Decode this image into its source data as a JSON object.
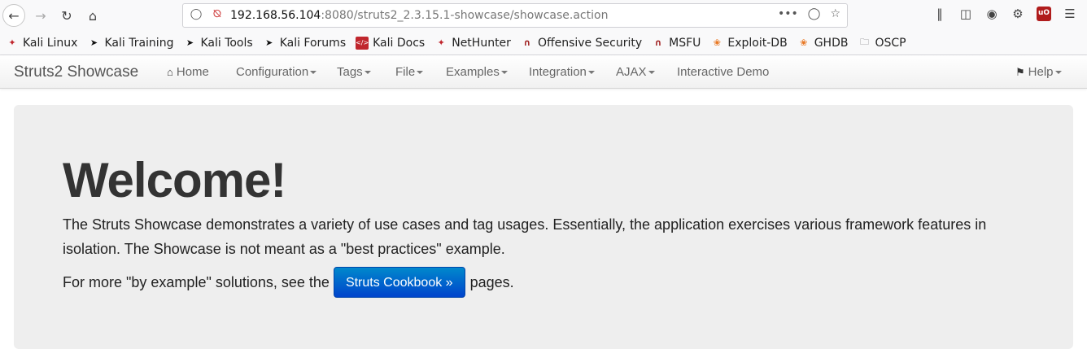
{
  "browser": {
    "url_host": "192.168.56.104",
    "url_path": ":8080/struts2_2.3.15.1-showcase/showcase.action",
    "bookmarks": [
      {
        "label": "Kali Linux",
        "icon": "kali-icon"
      },
      {
        "label": "Kali Training",
        "icon": "dragon-icon"
      },
      {
        "label": "Kali Tools",
        "icon": "dragon-icon"
      },
      {
        "label": "Kali Forums",
        "icon": "dragon-icon"
      },
      {
        "label": "Kali Docs",
        "icon": "docs-icon"
      },
      {
        "label": "NetHunter",
        "icon": "kali-icon"
      },
      {
        "label": "Offensive Security",
        "icon": "offsec-icon"
      },
      {
        "label": "MSFU",
        "icon": "offsec-icon"
      },
      {
        "label": "Exploit-DB",
        "icon": "exploit-icon"
      },
      {
        "label": "GHDB",
        "icon": "exploit-icon"
      },
      {
        "label": "OSCP",
        "icon": "folder-icon"
      }
    ]
  },
  "navbar": {
    "brand": "Struts2 Showcase",
    "items": [
      "Home",
      "Configuration",
      "Tags",
      "File",
      "Examples",
      "Integration",
      "AJAX",
      "Interactive Demo"
    ],
    "help": "Help"
  },
  "main": {
    "heading": "Welcome!",
    "lead": "The Struts Showcase demonstrates a variety of use cases and tag usages. Essentially, the application exercises various framework features in isolation. The Showcase is not meant as a \"best practices\" example.",
    "more_prefix": "For more \"by example\" solutions, see the",
    "cookbook_button": "Struts Cookbook »",
    "more_suffix": "pages."
  }
}
